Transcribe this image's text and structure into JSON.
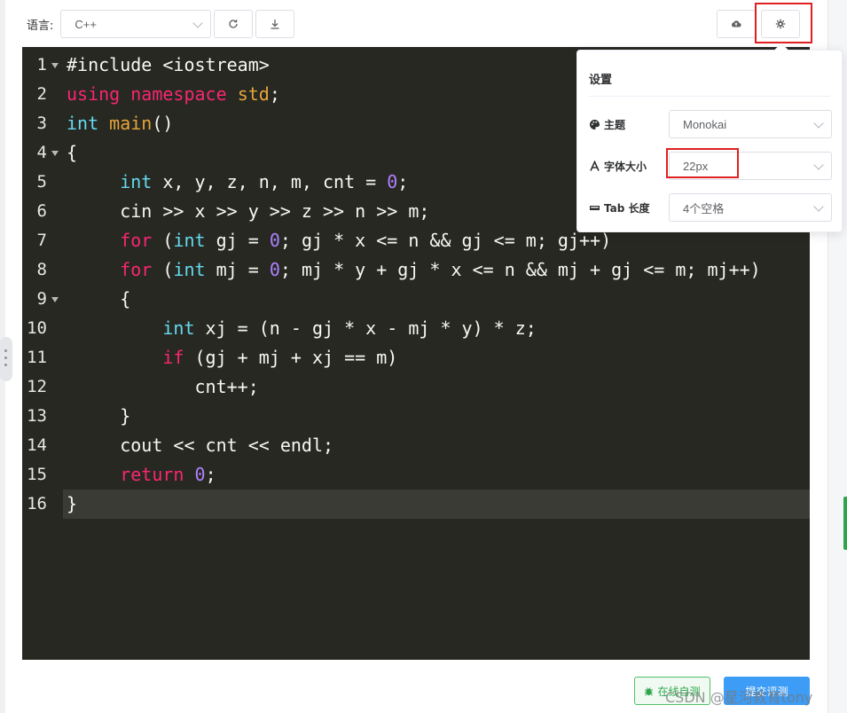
{
  "toolbar": {
    "language_label": "语言:",
    "language_value": "C++",
    "reset_icon": "refresh-icon",
    "download_icon": "download-icon",
    "upload_icon": "cloud-upload-icon",
    "settings_icon": "gear-icon"
  },
  "editor": {
    "theme_colors": {
      "background": "#272822",
      "keyword": "#f92672",
      "type": "#66d9ef",
      "function": "#e6a53b",
      "number": "#ae81ff",
      "text": "#f8f8f2"
    },
    "lines": [
      {
        "n": "1",
        "tokens": [
          {
            "t": "#include <iostream>",
            "c": ""
          }
        ]
      },
      {
        "n": "2",
        "tokens": [
          {
            "t": "using",
            "c": "kw"
          },
          {
            "t": " ",
            "c": ""
          },
          {
            "t": "namespace",
            "c": "kw"
          },
          {
            "t": " ",
            "c": ""
          },
          {
            "t": "std",
            "c": "fn"
          },
          {
            "t": ";",
            "c": ""
          }
        ]
      },
      {
        "n": "3",
        "tokens": [
          {
            "t": "int",
            "c": "ty"
          },
          {
            "t": " ",
            "c": ""
          },
          {
            "t": "main",
            "c": "fn"
          },
          {
            "t": "()",
            "c": ""
          }
        ]
      },
      {
        "n": "4",
        "tokens": [
          {
            "t": "{",
            "c": ""
          }
        ]
      },
      {
        "n": "5",
        "tokens": [
          {
            "t": "     ",
            "c": ""
          },
          {
            "t": "int",
            "c": "ty"
          },
          {
            "t": " x, y, z, n, m, cnt = ",
            "c": ""
          },
          {
            "t": "0",
            "c": "num"
          },
          {
            "t": ";",
            "c": ""
          }
        ]
      },
      {
        "n": "6",
        "tokens": [
          {
            "t": "     cin >> x >> y >> z >> n >> m;",
            "c": ""
          }
        ]
      },
      {
        "n": "7",
        "tokens": [
          {
            "t": "     ",
            "c": ""
          },
          {
            "t": "for",
            "c": "kw"
          },
          {
            "t": " (",
            "c": ""
          },
          {
            "t": "int",
            "c": "ty"
          },
          {
            "t": " gj = ",
            "c": ""
          },
          {
            "t": "0",
            "c": "num"
          },
          {
            "t": "; gj * x <= n && gj <= m; gj++)",
            "c": ""
          }
        ]
      },
      {
        "n": "8",
        "tokens": [
          {
            "t": "     ",
            "c": ""
          },
          {
            "t": "for",
            "c": "kw"
          },
          {
            "t": " (",
            "c": ""
          },
          {
            "t": "int",
            "c": "ty"
          },
          {
            "t": " mj = ",
            "c": ""
          },
          {
            "t": "0",
            "c": "num"
          },
          {
            "t": "; mj * y + gj * x <= n && mj + gj <= m; mj++)",
            "c": ""
          }
        ]
      },
      {
        "n": "9",
        "tokens": [
          {
            "t": "     {",
            "c": ""
          }
        ]
      },
      {
        "n": "10",
        "tokens": [
          {
            "t": "         ",
            "c": ""
          },
          {
            "t": "int",
            "c": "ty"
          },
          {
            "t": " xj = (n - gj * x - mj * y) * z;",
            "c": ""
          }
        ]
      },
      {
        "n": "11",
        "tokens": [
          {
            "t": "         ",
            "c": ""
          },
          {
            "t": "if",
            "c": "kw"
          },
          {
            "t": " (gj + mj + xj == m)",
            "c": ""
          }
        ]
      },
      {
        "n": "12",
        "tokens": [
          {
            "t": "            cnt++;",
            "c": ""
          }
        ]
      },
      {
        "n": "13",
        "tokens": [
          {
            "t": "     }",
            "c": ""
          }
        ]
      },
      {
        "n": "14",
        "tokens": [
          {
            "t": "     cout << cnt << endl;",
            "c": ""
          }
        ]
      },
      {
        "n": "15",
        "tokens": [
          {
            "t": "     ",
            "c": ""
          },
          {
            "t": "return",
            "c": "kw"
          },
          {
            "t": " ",
            "c": ""
          },
          {
            "t": "0",
            "c": "num"
          },
          {
            "t": ";",
            "c": ""
          }
        ]
      },
      {
        "n": "16",
        "tokens": [
          {
            "t": "}",
            "c": ""
          }
        ]
      }
    ],
    "fold_lines": [
      "1",
      "4",
      "9"
    ],
    "active_line": "16"
  },
  "settings": {
    "title": "设置",
    "theme_label": "主题",
    "theme_value": "Monokai",
    "font_size_label": "字体大小",
    "font_size_value": "22px",
    "tab_label": "Tab 长度",
    "tab_value": "4个空格"
  },
  "footer": {
    "run_label": "在线自测",
    "submit_label": "提交评测",
    "watermark": "CSDN @星河教育tony"
  }
}
